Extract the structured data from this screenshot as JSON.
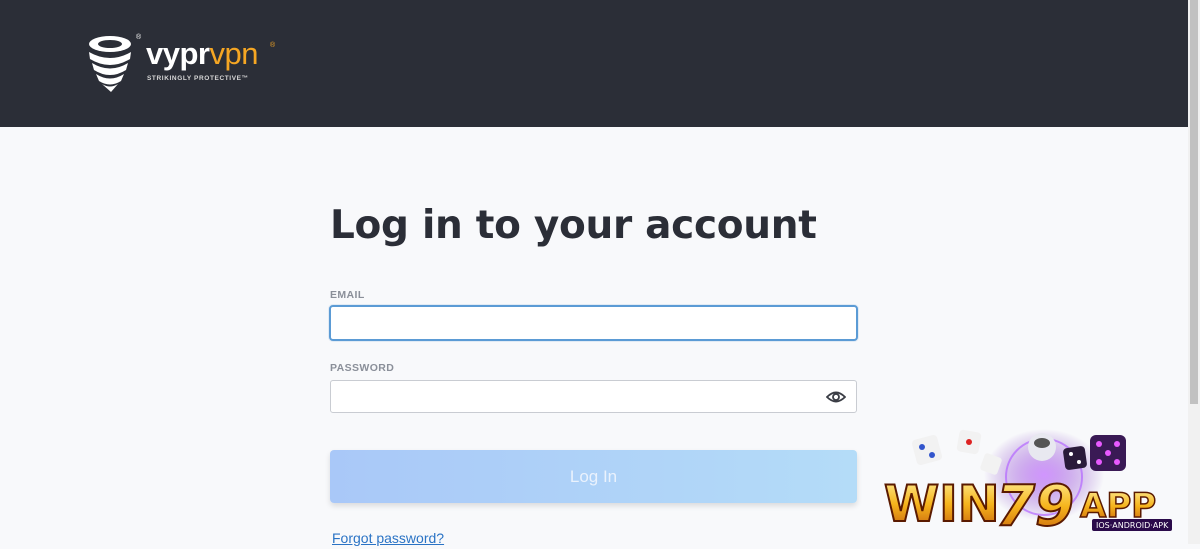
{
  "header": {
    "logo_text_1": "vypr",
    "logo_text_2": "vpn",
    "logo_tagline": "STRIKINGLY PROTECTIVE™",
    "logo_reg": "®",
    "logo_icon": "snake-coil-icon"
  },
  "main": {
    "title": "Log in to your account",
    "email_label": "EMAIL",
    "email_value": "",
    "password_label": "PASSWORD",
    "password_value": "",
    "show_password_icon": "eye-icon",
    "login_button": "Log In",
    "forgot_link": "Forgot password?"
  },
  "overlay": {
    "brand_1": "WIN",
    "brand_2": "79",
    "brand_3": "APP",
    "brand_sub": "IOS·ANDROID·APK",
    "icons": "dice-icons"
  },
  "colors": {
    "header_bg": "#2b2e37",
    "accent": "#f5a623",
    "button_bg": "#a9c8f8",
    "link": "#2a73c5",
    "focus_border": "#5b9bd5"
  }
}
